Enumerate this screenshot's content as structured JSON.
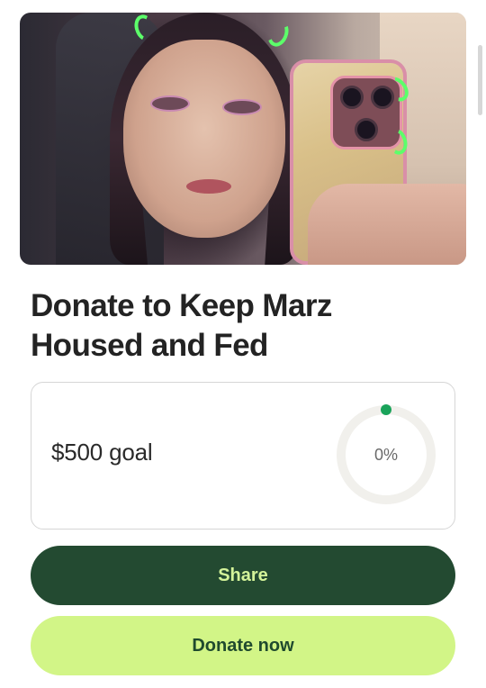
{
  "campaign": {
    "title": "Donate to Keep Marz Housed and Fed",
    "goal_text": "$500 goal",
    "progress_percent": 0,
    "progress_label": "0%"
  },
  "actions": {
    "share_label": "Share",
    "donate_label": "Donate now"
  },
  "colors": {
    "share_bg": "#234a31",
    "share_text": "#d4f49a",
    "donate_bg": "#d2f587",
    "donate_text": "#1f4a2e",
    "progress_dot": "#1aa35a",
    "progress_track": "#f1f0ec"
  }
}
